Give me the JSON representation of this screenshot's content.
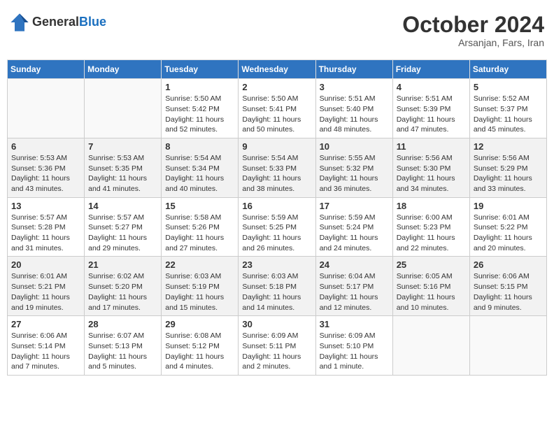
{
  "header": {
    "logo_line1": "General",
    "logo_line2": "Blue",
    "month": "October 2024",
    "location": "Arsanjan, Fars, Iran"
  },
  "days_of_week": [
    "Sunday",
    "Monday",
    "Tuesday",
    "Wednesday",
    "Thursday",
    "Friday",
    "Saturday"
  ],
  "weeks": [
    [
      {
        "day": "",
        "info": ""
      },
      {
        "day": "",
        "info": ""
      },
      {
        "day": "1",
        "info": "Sunrise: 5:50 AM\nSunset: 5:42 PM\nDaylight: 11 hours and 52 minutes."
      },
      {
        "day": "2",
        "info": "Sunrise: 5:50 AM\nSunset: 5:41 PM\nDaylight: 11 hours and 50 minutes."
      },
      {
        "day": "3",
        "info": "Sunrise: 5:51 AM\nSunset: 5:40 PM\nDaylight: 11 hours and 48 minutes."
      },
      {
        "day": "4",
        "info": "Sunrise: 5:51 AM\nSunset: 5:39 PM\nDaylight: 11 hours and 47 minutes."
      },
      {
        "day": "5",
        "info": "Sunrise: 5:52 AM\nSunset: 5:37 PM\nDaylight: 11 hours and 45 minutes."
      }
    ],
    [
      {
        "day": "6",
        "info": "Sunrise: 5:53 AM\nSunset: 5:36 PM\nDaylight: 11 hours and 43 minutes."
      },
      {
        "day": "7",
        "info": "Sunrise: 5:53 AM\nSunset: 5:35 PM\nDaylight: 11 hours and 41 minutes."
      },
      {
        "day": "8",
        "info": "Sunrise: 5:54 AM\nSunset: 5:34 PM\nDaylight: 11 hours and 40 minutes."
      },
      {
        "day": "9",
        "info": "Sunrise: 5:54 AM\nSunset: 5:33 PM\nDaylight: 11 hours and 38 minutes."
      },
      {
        "day": "10",
        "info": "Sunrise: 5:55 AM\nSunset: 5:32 PM\nDaylight: 11 hours and 36 minutes."
      },
      {
        "day": "11",
        "info": "Sunrise: 5:56 AM\nSunset: 5:30 PM\nDaylight: 11 hours and 34 minutes."
      },
      {
        "day": "12",
        "info": "Sunrise: 5:56 AM\nSunset: 5:29 PM\nDaylight: 11 hours and 33 minutes."
      }
    ],
    [
      {
        "day": "13",
        "info": "Sunrise: 5:57 AM\nSunset: 5:28 PM\nDaylight: 11 hours and 31 minutes."
      },
      {
        "day": "14",
        "info": "Sunrise: 5:57 AM\nSunset: 5:27 PM\nDaylight: 11 hours and 29 minutes."
      },
      {
        "day": "15",
        "info": "Sunrise: 5:58 AM\nSunset: 5:26 PM\nDaylight: 11 hours and 27 minutes."
      },
      {
        "day": "16",
        "info": "Sunrise: 5:59 AM\nSunset: 5:25 PM\nDaylight: 11 hours and 26 minutes."
      },
      {
        "day": "17",
        "info": "Sunrise: 5:59 AM\nSunset: 5:24 PM\nDaylight: 11 hours and 24 minutes."
      },
      {
        "day": "18",
        "info": "Sunrise: 6:00 AM\nSunset: 5:23 PM\nDaylight: 11 hours and 22 minutes."
      },
      {
        "day": "19",
        "info": "Sunrise: 6:01 AM\nSunset: 5:22 PM\nDaylight: 11 hours and 20 minutes."
      }
    ],
    [
      {
        "day": "20",
        "info": "Sunrise: 6:01 AM\nSunset: 5:21 PM\nDaylight: 11 hours and 19 minutes."
      },
      {
        "day": "21",
        "info": "Sunrise: 6:02 AM\nSunset: 5:20 PM\nDaylight: 11 hours and 17 minutes."
      },
      {
        "day": "22",
        "info": "Sunrise: 6:03 AM\nSunset: 5:19 PM\nDaylight: 11 hours and 15 minutes."
      },
      {
        "day": "23",
        "info": "Sunrise: 6:03 AM\nSunset: 5:18 PM\nDaylight: 11 hours and 14 minutes."
      },
      {
        "day": "24",
        "info": "Sunrise: 6:04 AM\nSunset: 5:17 PM\nDaylight: 11 hours and 12 minutes."
      },
      {
        "day": "25",
        "info": "Sunrise: 6:05 AM\nSunset: 5:16 PM\nDaylight: 11 hours and 10 minutes."
      },
      {
        "day": "26",
        "info": "Sunrise: 6:06 AM\nSunset: 5:15 PM\nDaylight: 11 hours and 9 minutes."
      }
    ],
    [
      {
        "day": "27",
        "info": "Sunrise: 6:06 AM\nSunset: 5:14 PM\nDaylight: 11 hours and 7 minutes."
      },
      {
        "day": "28",
        "info": "Sunrise: 6:07 AM\nSunset: 5:13 PM\nDaylight: 11 hours and 5 minutes."
      },
      {
        "day": "29",
        "info": "Sunrise: 6:08 AM\nSunset: 5:12 PM\nDaylight: 11 hours and 4 minutes."
      },
      {
        "day": "30",
        "info": "Sunrise: 6:09 AM\nSunset: 5:11 PM\nDaylight: 11 hours and 2 minutes."
      },
      {
        "day": "31",
        "info": "Sunrise: 6:09 AM\nSunset: 5:10 PM\nDaylight: 11 hours and 1 minute."
      },
      {
        "day": "",
        "info": ""
      },
      {
        "day": "",
        "info": ""
      }
    ]
  ]
}
